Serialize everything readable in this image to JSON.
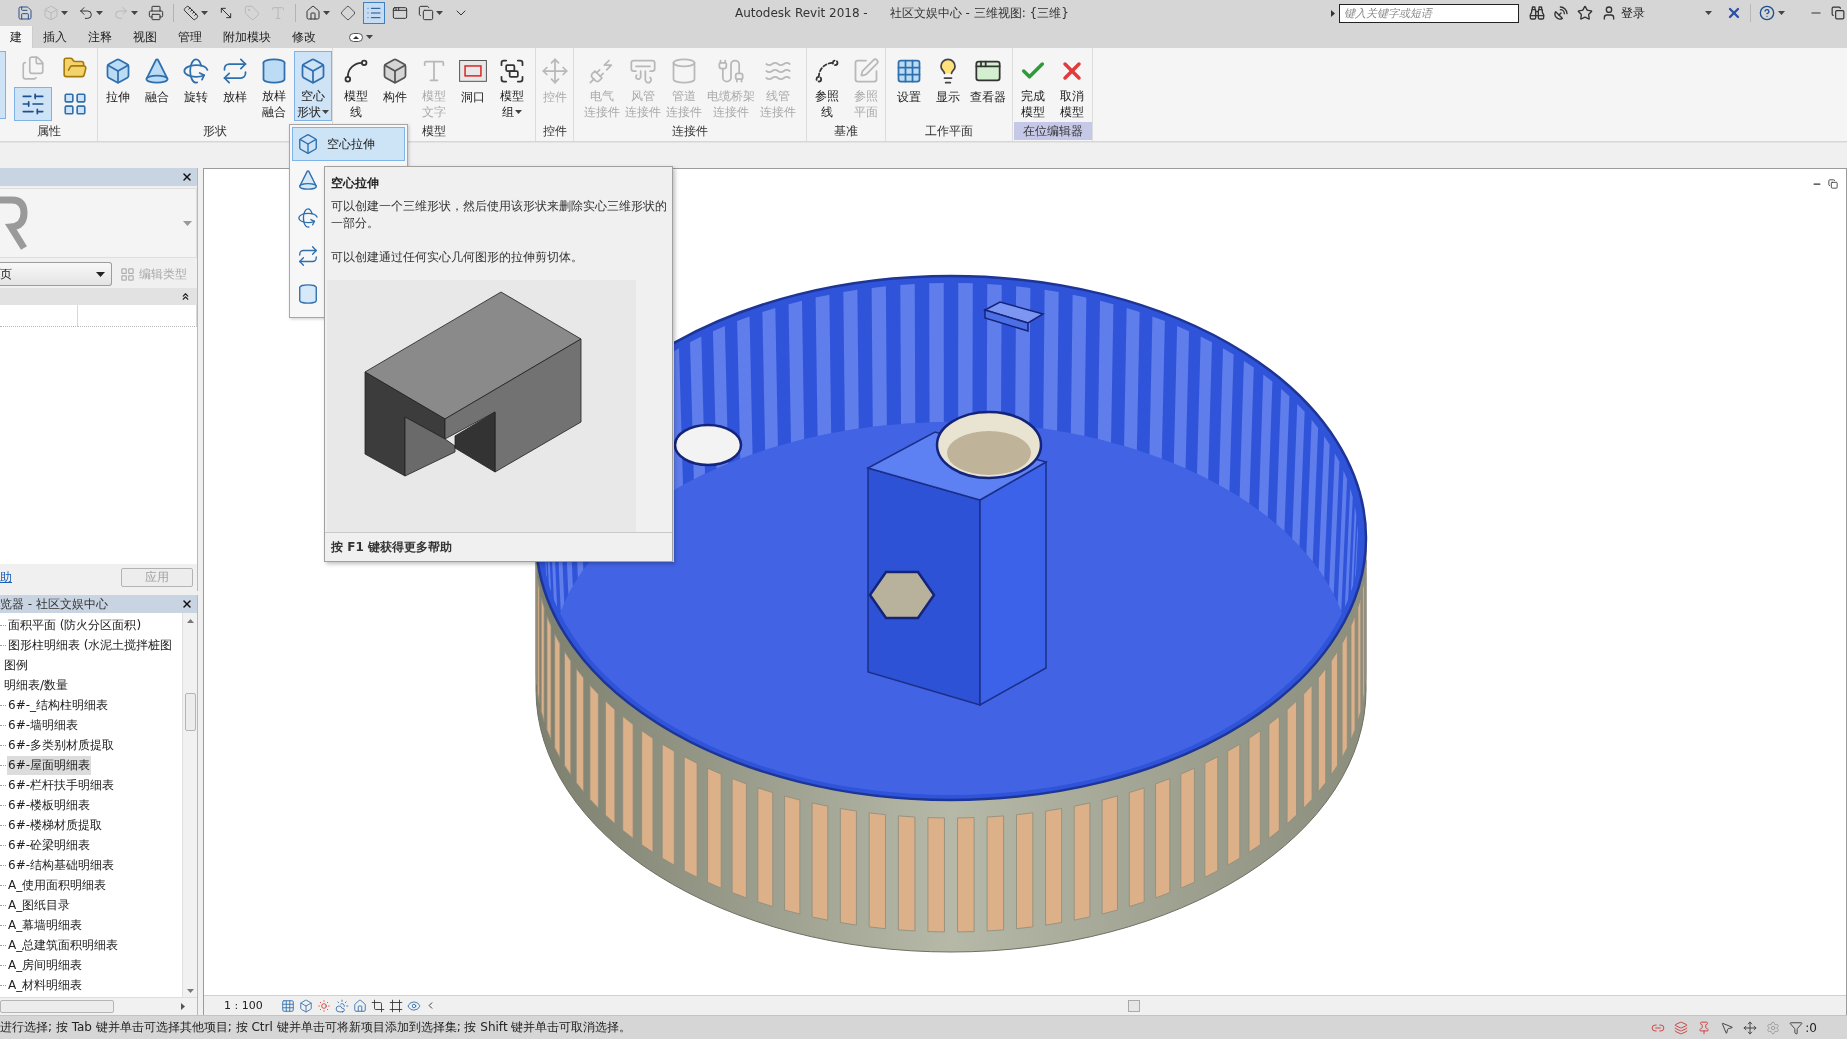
{
  "title_bar": {
    "quick_access": [
      [
        {
          "on": false,
          "disabled": false,
          "has_menu": false
        },
        {
          "on": false,
          "disabled": true,
          "has_menu": true
        },
        {
          "on": false,
          "disabled": false,
          "has_menu": true
        },
        {
          "on": false,
          "disabled": true,
          "has_menu": true
        },
        {
          "on": false,
          "disabled": false,
          "has_menu": false
        }
      ],
      [
        {
          "on": false,
          "disabled": false,
          "has_menu": true
        },
        {
          "on": false,
          "disabled": false,
          "has_menu": false
        },
        {
          "on": false,
          "disabled": true,
          "has_menu": false
        },
        {
          "on": false,
          "disabled": true,
          "has_menu": false
        }
      ],
      [
        {
          "on": false,
          "disabled": false,
          "has_menu": true
        },
        {
          "on": false,
          "disabled": false,
          "has_menu": false
        },
        {
          "on": true,
          "disabled": false,
          "has_menu": false
        },
        {
          "on": false,
          "disabled": false,
          "has_menu": false
        },
        {
          "on": false,
          "disabled": false,
          "has_menu": true
        },
        {
          "on": false,
          "disabled": false,
          "has_menu": false
        }
      ]
    ],
    "app_title": "Autodesk Revit 2018 -",
    "document_title": "社区文娱中心 - 三维视图: {三维}",
    "search": {
      "placeholder": "键入关键字或短语"
    },
    "sign_in": "登录"
  },
  "tabs": [
    {
      "label": "建",
      "selected": true
    },
    {
      "label": "插入",
      "selected": false
    },
    {
      "label": "注释",
      "selected": false
    },
    {
      "label": "视图",
      "selected": false
    },
    {
      "label": "管理",
      "selected": false
    },
    {
      "label": "附加模块",
      "selected": false
    },
    {
      "label": "修改",
      "selected": false
    }
  ],
  "ribbon": {
    "panels": [
      {
        "title": "属性",
        "kind": "grid",
        "contextual": false,
        "edge_button": {
          "on": true
        },
        "tools": [
          {
            "on": false,
            "disabled": true,
            "has_menu": false
          },
          {
            "on": false,
            "disabled": false,
            "has_menu": false
          },
          {
            "on": true,
            "disabled": false,
            "has_menu": false
          },
          {
            "on": false,
            "disabled": false,
            "has_menu": false
          }
        ]
      },
      {
        "title": "形状",
        "kind": "row",
        "contextual": false,
        "tools": [
          {
            "label": [
              "拉伸"
            ],
            "on": false,
            "disabled": false,
            "has_menu": false
          },
          {
            "label": [
              "融合"
            ],
            "on": false,
            "disabled": false,
            "has_menu": false
          },
          {
            "label": [
              "旋转"
            ],
            "on": false,
            "disabled": false,
            "has_menu": false
          },
          {
            "label": [
              "放样"
            ],
            "on": false,
            "disabled": false,
            "has_menu": false
          },
          {
            "label": [
              "放样",
              "融合"
            ],
            "on": false,
            "disabled": false,
            "has_menu": false
          },
          {
            "label": [
              "空心",
              "形状"
            ],
            "on": true,
            "disabled": false,
            "has_menu": true
          }
        ]
      },
      {
        "title": "模型",
        "kind": "row",
        "contextual": false,
        "tools": [
          {
            "label": [
              "模型",
              "线"
            ],
            "on": false,
            "disabled": false,
            "has_menu": false
          },
          {
            "label": [
              "构件"
            ],
            "on": false,
            "disabled": false,
            "has_menu": false
          },
          {
            "label": [
              "模型",
              "文字"
            ],
            "on": false,
            "disabled": true,
            "has_menu": false
          },
          {
            "label": [
              "洞口"
            ],
            "on": false,
            "disabled": false,
            "has_menu": false
          },
          {
            "label": [
              "模型",
              "组"
            ],
            "on": false,
            "disabled": false,
            "has_menu": true
          }
        ]
      },
      {
        "title": "控件",
        "kind": "row",
        "contextual": false,
        "tools": [
          {
            "label": [
              "控件"
            ],
            "on": false,
            "disabled": true,
            "has_menu": false
          }
        ]
      },
      {
        "title": "连接件",
        "kind": "row",
        "contextual": false,
        "tools": [
          {
            "label": [
              "电气",
              "连接件"
            ],
            "on": false,
            "disabled": true,
            "has_menu": false
          },
          {
            "label": [
              "风管",
              "连接件"
            ],
            "on": false,
            "disabled": true,
            "has_menu": false
          },
          {
            "label": [
              "管道",
              "连接件"
            ],
            "on": false,
            "disabled": true,
            "has_menu": false
          },
          {
            "label": [
              "电缆桥架",
              "连接件"
            ],
            "on": false,
            "disabled": true,
            "has_menu": false
          },
          {
            "label": [
              "线管",
              "连接件"
            ],
            "on": false,
            "disabled": true,
            "has_menu": false
          }
        ]
      },
      {
        "title": "基准",
        "kind": "row",
        "contextual": false,
        "tools": [
          {
            "label": [
              "参照",
              "线"
            ],
            "on": false,
            "disabled": false,
            "has_menu": false
          },
          {
            "label": [
              "参照",
              "平面"
            ],
            "on": false,
            "disabled": true,
            "has_menu": false
          }
        ]
      },
      {
        "title": "工作平面",
        "kind": "row",
        "contextual": false,
        "tools": [
          {
            "label": [
              "设置"
            ],
            "on": false,
            "disabled": false,
            "has_menu": false
          },
          {
            "label": [
              "显示"
            ],
            "on": false,
            "disabled": false,
            "has_menu": false
          },
          {
            "label": [
              "查看器"
            ],
            "on": false,
            "disabled": false,
            "has_menu": false
          }
        ]
      },
      {
        "title": "在位编辑器",
        "kind": "row",
        "contextual": true,
        "tools": [
          {
            "label": [
              "完成",
              "模型"
            ],
            "on": false,
            "disabled": false,
            "has_menu": false
          },
          {
            "label": [
              "取消",
              "模型"
            ],
            "on": false,
            "disabled": false,
            "has_menu": false
          }
        ]
      }
    ]
  },
  "shape_menu": {
    "items": [
      {
        "label": "空心拉伸",
        "selected": true
      },
      {
        "selected": false
      },
      {
        "selected": false
      },
      {
        "selected": false
      },
      {
        "selected": false
      }
    ]
  },
  "tooltip": {
    "title": "空心拉伸",
    "paragraphs": [
      "可以创建一个三维形状，然后使用该形状来删除实心三维形状的一部分。",
      "可以创建通过任何实心几何图形的拉伸剪切体。"
    ],
    "footer": "按 F1 键获得更多帮助"
  },
  "properties": {
    "type_selector": {
      "value": "页"
    },
    "edit_type": {
      "label": "编辑类型",
      "disabled": true
    },
    "help_link": "助",
    "apply": {
      "label": "应用",
      "disabled": true
    }
  },
  "project_browser": {
    "title": "览器 - 社区文娱中心",
    "continued_children": [
      {
        "label": "面积平面 (防火分区面积)",
        "selected": false
      },
      {
        "label": "图形柱明细表 (水泥土搅拌桩图",
        "selected": false
      }
    ],
    "items": [
      {
        "label": "图例",
        "selected": false
      },
      {
        "label": "明细表/数量",
        "selected": false,
        "children": [
          {
            "label": "6#-_结构柱明细表",
            "selected": false
          },
          {
            "label": "6#-墙明细表",
            "selected": false
          },
          {
            "label": "6#-多类别材质提取",
            "selected": false
          },
          {
            "label": "6#-屋面明细表",
            "selected": true
          },
          {
            "label": "6#-栏杆扶手明细表",
            "selected": false
          },
          {
            "label": "6#-楼板明细表",
            "selected": false
          },
          {
            "label": "6#-楼梯材质提取",
            "selected": false
          },
          {
            "label": "6#-砼梁明细表",
            "selected": false
          },
          {
            "label": "6#-结构基础明细表",
            "selected": false
          },
          {
            "label": "A_使用面积明细表",
            "selected": false
          },
          {
            "label": "A_图纸目录",
            "selected": false
          },
          {
            "label": "A_幕墙明细表",
            "selected": false
          },
          {
            "label": "A_总建筑面积明细表",
            "selected": false
          },
          {
            "label": "A_房间明细表",
            "selected": false
          },
          {
            "label": "A_材料明细表",
            "selected": false
          }
        ]
      }
    ]
  },
  "view": {
    "scale": "1 : 100"
  },
  "status_bar": {
    "message": "进行选择; 按 Tab 键并单击可选择其他项目; 按 Ctrl 键并单击可将新项目添加到选择集; 按 Shift 键并单击可取消选择。",
    "filter_count": ":0"
  }
}
